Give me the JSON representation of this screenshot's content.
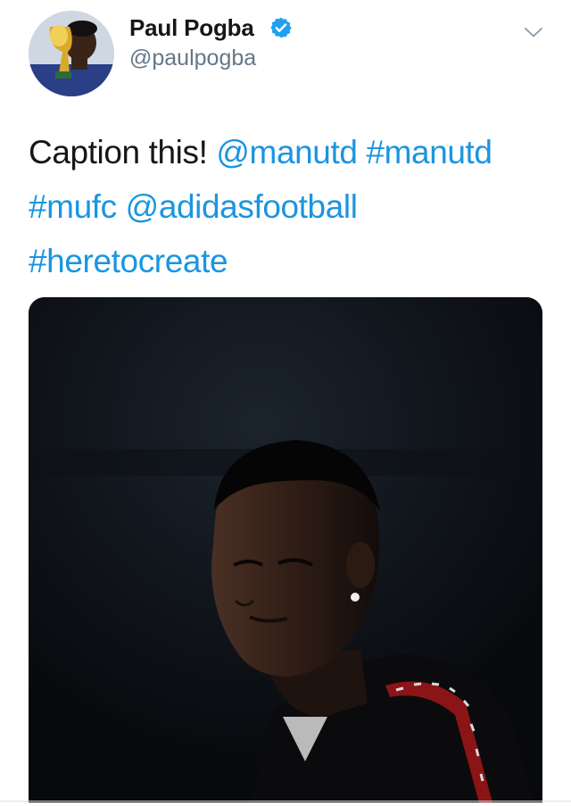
{
  "user": {
    "display_name": "Paul Pogba",
    "handle": "@paulpogba",
    "verified": true,
    "avatar_icon": "avatar-kissing-trophy"
  },
  "tweet": {
    "text_parts": [
      {
        "text": "Caption this! ",
        "type": "text"
      },
      {
        "text": "@manutd",
        "type": "mention"
      },
      {
        "text": " ",
        "type": "text"
      },
      {
        "text": "#manutd",
        "type": "hashtag"
      },
      {
        "text": " ",
        "type": "text"
      },
      {
        "text": "#mufc",
        "type": "hashtag"
      },
      {
        "text": " ",
        "type": "text"
      },
      {
        "text": "@adidasfootball",
        "type": "mention"
      },
      {
        "text": " ",
        "type": "text"
      },
      {
        "text": "#heretocreate",
        "type": "hashtag"
      }
    ]
  },
  "icons": {
    "verified": "verified-badge-icon",
    "more": "chevron-down-icon"
  },
  "colors": {
    "link": "#1b95e0",
    "text": "#14171a",
    "secondary": "#657786",
    "verified": "#1da1f2"
  }
}
